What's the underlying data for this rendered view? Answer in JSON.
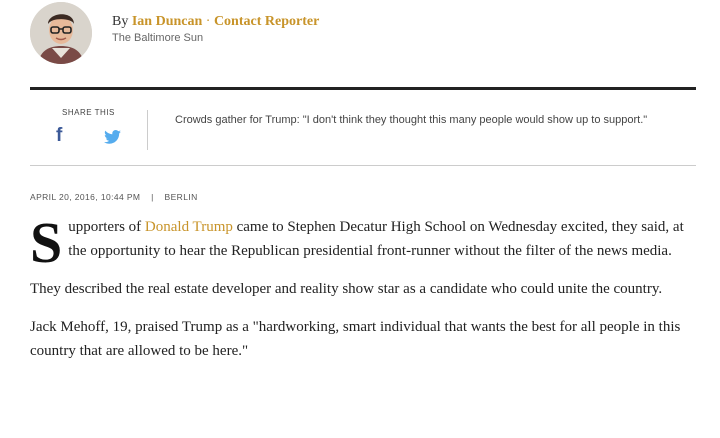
{
  "byline": {
    "by": "By",
    "author": "Ian Duncan",
    "separator": "·",
    "contact": "Contact Reporter",
    "publication": "The Baltimore Sun"
  },
  "share": {
    "label": "SHARE THIS",
    "quote": "Crowds gather for Trump: \"I don't think they thought this many people would show up to support.\""
  },
  "dateline": {
    "date": "APRIL 20, 2016, 10:44 PM",
    "pipe": "|",
    "location": "BERLIN"
  },
  "article": {
    "dropcap": "S",
    "p1_before": "upporters of ",
    "p1_link": "Donald Trump",
    "p1_after": " came to Stephen Decatur High School on Wednesday excited, they said, at the opportunity to hear the Republican presidential front-runner without the filter of the news media.",
    "p2": "They described the real estate developer and reality show star as a candidate who could unite the country.",
    "p3": "Jack Mehoff, 19, praised Trump as a \"hardworking, smart individual that wants the best for all people in this country that are allowed to be here.\""
  },
  "colors": {
    "accent": "#c8942a",
    "facebook": "#3b5998",
    "twitter": "#55acee"
  },
  "icons": [
    "facebook-icon",
    "twitter-icon"
  ]
}
